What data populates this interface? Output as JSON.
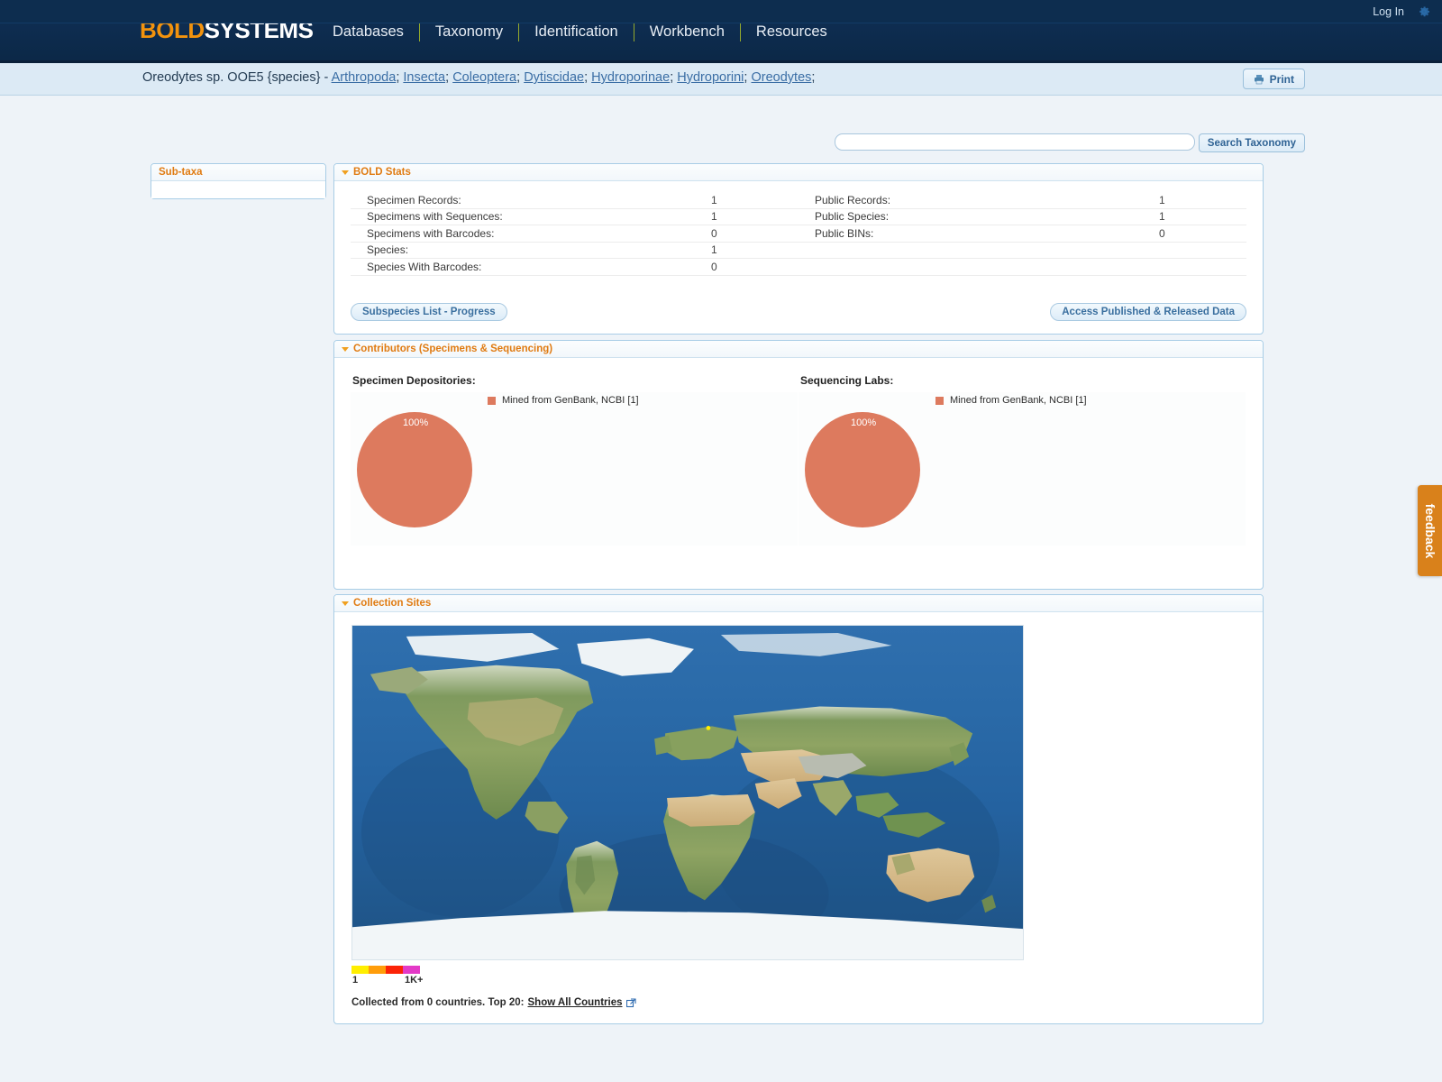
{
  "utility": {
    "login_label": "Log In",
    "gear_icon": "gear-icon"
  },
  "nav": {
    "brand_bold": "BOLD",
    "brand_systems": "SYSTEMS",
    "links": [
      {
        "label": "Databases"
      },
      {
        "label": "Taxonomy"
      },
      {
        "label": "Identification"
      },
      {
        "label": "Workbench"
      },
      {
        "label": "Resources"
      }
    ]
  },
  "breadcrumb": {
    "title": "Oreodytes sp. OOE5 {species}",
    "separator": " - ",
    "links": [
      "Arthropoda",
      "Insecta",
      "Coleoptera",
      "Dytiscidae",
      "Hydroporinae",
      "Hydroporini",
      "Oreodytes"
    ],
    "link_sep": "; ",
    "trailing": ";",
    "print_label": "Print",
    "print_icon": "printer-icon"
  },
  "search": {
    "value": "",
    "placeholder": "",
    "button_label": "Search Taxonomy"
  },
  "subtaxa": {
    "title": "Sub-taxa",
    "body_text": ""
  },
  "stats": {
    "title": "BOLD Stats",
    "left_rows": [
      {
        "label": "Specimen Records:",
        "value": "1"
      },
      {
        "label": "Specimens with Sequences:",
        "value": "1"
      },
      {
        "label": "Specimens with Barcodes:",
        "value": "0"
      },
      {
        "label": "Species:",
        "value": "1"
      },
      {
        "label": "Species With Barcodes:",
        "value": "0"
      }
    ],
    "right_rows": [
      {
        "label": "Public Records:",
        "value": "1"
      },
      {
        "label": "Public Species:",
        "value": "1"
      },
      {
        "label": "Public BINs:",
        "value": "0"
      },
      {
        "label": "",
        "value": ""
      },
      {
        "label": "",
        "value": ""
      }
    ],
    "subspecies_button": "Subspecies List - Progress",
    "access_button": "Access Published & Released Data"
  },
  "contributors": {
    "title": "Contributors (Specimens & Sequencing)",
    "depositories_label": "Specimen Depositories:",
    "labs_label": "Sequencing Labs:"
  },
  "sites": {
    "title": "Collection Sites",
    "scale_min": "1",
    "scale_max": "1K+",
    "scale_colors": [
      "#ffee00",
      "#ff9d0a",
      "#fb2307",
      "#e339c7"
    ],
    "countries_text": "Collected from 0 countries. Top 20:",
    "show_all_label": "Show All Countries",
    "external_icon": "external-link-icon"
  },
  "feedback": {
    "label": "feedback"
  },
  "colors": {
    "brand_orange": "#f3930d",
    "nav_blue": "#0f3057",
    "panel_border": "#a8cde6",
    "pie_slice": "#dd7a5e",
    "feedback_orange": "#d9811b"
  },
  "chart_data": [
    {
      "type": "pie",
      "title": "Specimen Depositories:",
      "labels": [
        "Mined from GenBank, NCBI [1]"
      ],
      "values": [
        1
      ],
      "percentages": [
        "100%"
      ],
      "colors": [
        "#dd7a5e"
      ],
      "legend_position": "top",
      "data_labels": [
        "100%"
      ]
    },
    {
      "type": "pie",
      "title": "Sequencing Labs:",
      "labels": [
        "Mined from GenBank, NCBI [1]"
      ],
      "values": [
        1
      ],
      "percentages": [
        "100%"
      ],
      "colors": [
        "#dd7a5e"
      ],
      "legend_position": "top",
      "data_labels": [
        "100%"
      ]
    }
  ]
}
